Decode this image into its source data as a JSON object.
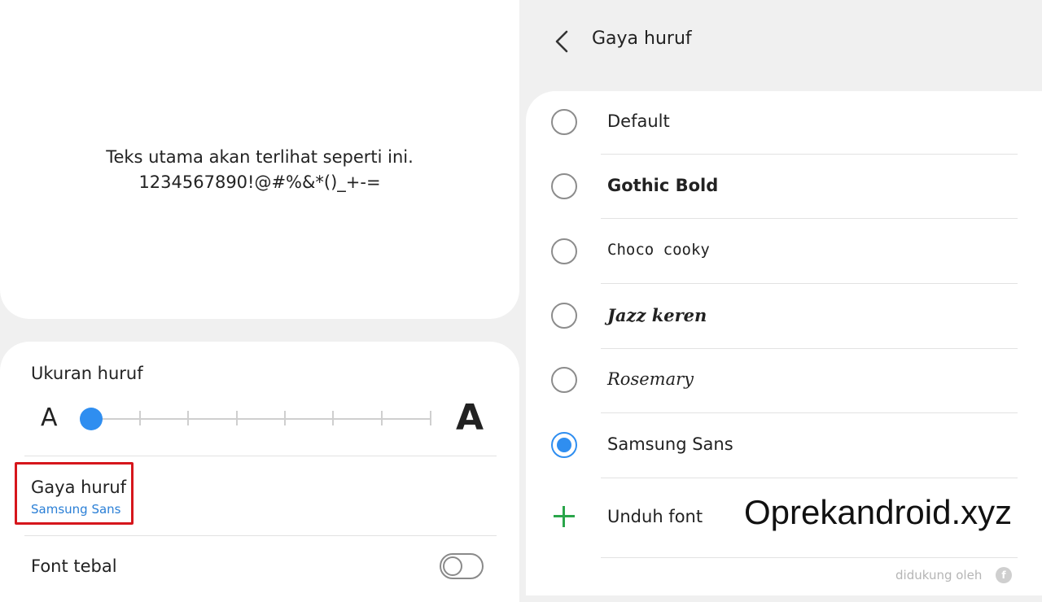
{
  "preview": {
    "line1": "Teks utama akan terlihat seperti ini.",
    "line2": "1234567890!@#%&*()_+-="
  },
  "font_size": {
    "label": "Ukuran huruf",
    "small_glyph": "A",
    "large_glyph": "A",
    "slider_level": 0,
    "slider_steps": 8
  },
  "font_style": {
    "title": "Gaya huruf",
    "value": "Samsung Sans"
  },
  "bold_font": {
    "label": "Font tebal",
    "enabled": false
  },
  "font_page": {
    "title": "Gaya huruf",
    "options": [
      {
        "label": "Default",
        "selected": false
      },
      {
        "label": "Gothic Bold",
        "selected": false
      },
      {
        "label": "Choco cooky",
        "selected": false
      },
      {
        "label": "Jazz keren",
        "selected": false
      },
      {
        "label": "Rosemary",
        "selected": false
      },
      {
        "label": "Samsung Sans",
        "selected": true
      }
    ],
    "download_label": "Unduh font",
    "powered_by": "didukung oleh"
  },
  "watermark": "Oprekandroid.xyz",
  "colors": {
    "accent": "#2f8ef0",
    "highlight_box": "#d6161c",
    "download_plus": "#2aa54a",
    "subtitle": "#2a7fd6"
  },
  "icons": [
    "back-arrow-icon",
    "plus-icon",
    "radio-icon"
  ]
}
